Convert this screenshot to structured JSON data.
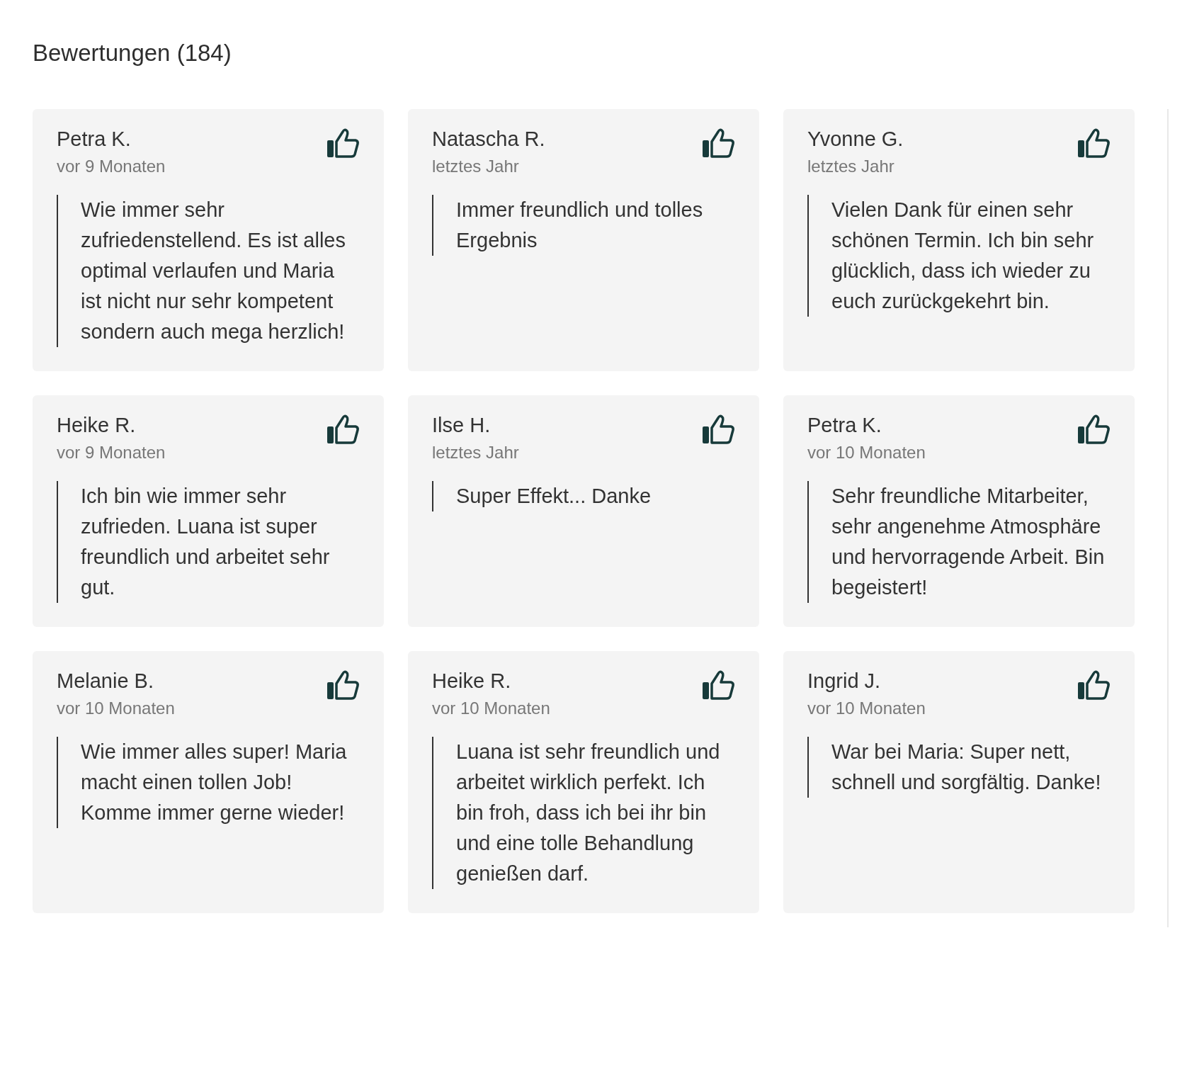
{
  "heading": "Bewertungen (184)",
  "reviews": [
    {
      "name": "Petra K.",
      "date": "vor 9 Monaten",
      "text": "Wie immer sehr zufriedenstellend. Es ist alles optimal verlaufen und Maria ist nicht nur sehr kompetent sondern auch mega herzlich!"
    },
    {
      "name": "Natascha R.",
      "date": "letztes Jahr",
      "text": "Immer freundlich und tolles Ergebnis"
    },
    {
      "name": "Yvonne G.",
      "date": "letztes Jahr",
      "text": "Vielen Dank für einen sehr schönen Termin. Ich bin sehr glücklich, dass ich wieder zu euch zurückgekehrt bin."
    },
    {
      "name": "Heike R.",
      "date": "vor 9 Monaten",
      "text": "Ich bin wie immer sehr zufrieden. Luana ist super freundlich und arbeitet sehr gut."
    },
    {
      "name": "Ilse H.",
      "date": "letztes Jahr",
      "text": "Super Effekt... Danke"
    },
    {
      "name": "Petra K.",
      "date": "vor 10 Monaten",
      "text": "Sehr freundliche Mitarbeiter, sehr angenehme Atmosphäre und hervorragende Arbeit. Bin begeistert!"
    },
    {
      "name": "Melanie B.",
      "date": "vor 10 Monaten",
      "text": "Wie immer alles super! Maria macht einen tollen Job! Komme immer gerne wieder!"
    },
    {
      "name": "Heike R.",
      "date": "vor 10 Monaten",
      "text": "Luana ist sehr freundlich und arbeitet wirklich perfekt. Ich bin froh, dass ich bei ihr bin und eine tolle Behandlung genießen darf."
    },
    {
      "name": "Ingrid J.",
      "date": "vor 10 Monaten",
      "text": "War bei Maria: Super nett, schnell und sorgfältig. Danke!"
    }
  ]
}
